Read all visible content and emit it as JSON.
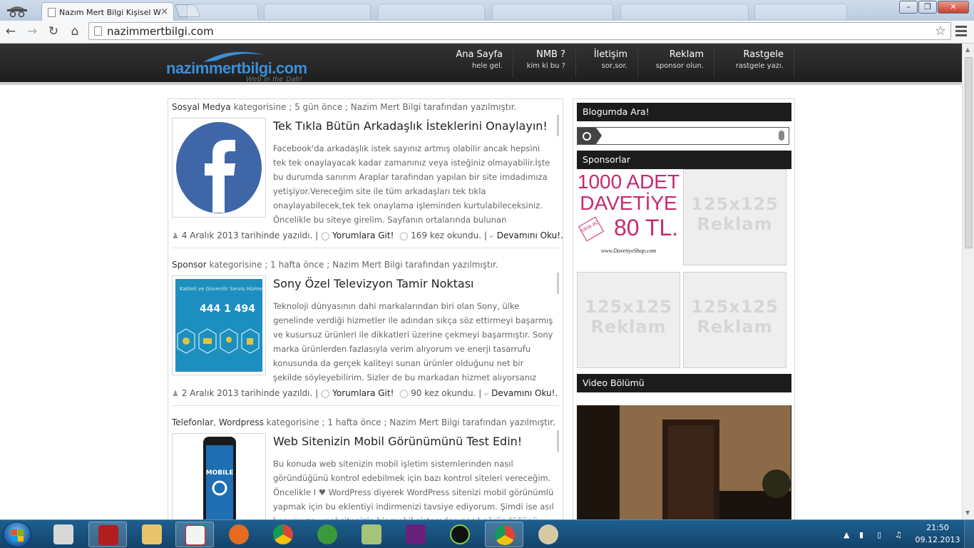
{
  "browser": {
    "active_tab_title": "Nazım Mert Bilgi Kişisel W",
    "url": "nazimmertbilgi.com",
    "close_glyph": "×"
  },
  "site": {
    "logo_text": "nazimmertbilgi.com",
    "logo_tagline": "Web in the Dah!",
    "nav": [
      {
        "title": "Ana Sayfa",
        "sub": "hele gel."
      },
      {
        "title": "NMB ?",
        "sub": "kim ki bu ?"
      },
      {
        "title": "İletişim",
        "sub": "sor,sor."
      },
      {
        "title": "Reklam",
        "sub": "sponsor olun."
      },
      {
        "title": "Rastgele",
        "sub": "rastgele yazı."
      }
    ]
  },
  "posts": [
    {
      "category": "Sosyal Medya",
      "meta_rest": " kategorisine ; 5 gün önce ;  Nazim Mert Bilgi  tarafından yazılmıştır.",
      "title": "Tek Tıkla Bütün Arkadaşlık İsteklerini Onaylayın!",
      "excerpt": "Facebook'da arkadaşlık istek sayınız artmış olabilir ancak hepsini tek tek onaylayacak kadar zamanınız veya isteğiniz olmayabilir.İşte bu durumda sanırım Araplar tarafından yapılan bir site imdadımıza yetişiyor.Vereceğim site ile tüm arkadaşları tek tıkla onaylayabilecek,tek tek onaylama işleminden kurtulabileceksiniz. Öncelikle bu siteye girelim. Sayfanın ortalarında bulunan",
      "date": "4 Aralık 2013 tarihinde yazıldı. |",
      "comments": "Yorumlara Git!",
      "views": "169 kez okundu. |",
      "more": "Devamını Oku!."
    },
    {
      "category": "Sponsor",
      "meta_rest": " kategorisine ; 1 hafta önce ;  Nazim Mert Bilgi  tarafından yazılmıştır.",
      "title": "Sony Özel Televizyon Tamir Noktası",
      "excerpt": "Teknoloji dünyasının dahi markalarından biri olan Sony, ülke genelinde verdiği hizmetler ile adından sıkça söz ettirmeyi başarmış ve kusursuz ürünleri ile dikkatleri üzerine çekmeyi başarmıştır. Sony marka ürünlerden fazlasıyla verim alıyorum ve enerji tasarrufu konusunda da gerçek kaliteyi sunan ürünler olduğunu net bir şekilde söyleyebilirim. Sizler de bu markadan hizmet alıyorsanız",
      "date": "2 Aralık 2013 tarihinde yazıldı. |",
      "comments": "Yorumlara Git!",
      "views": "90 kez okundu. |",
      "more": "Devamını Oku!.",
      "thumb_caption": "Kaliteli ve Güvenilir Servis Hizmeti",
      "thumb_phone": "444 1 494"
    },
    {
      "category": "Telefonlar",
      "category2": "Wordpress",
      "meta_rest": " kategorisine ; 1 hafta önce ;  Nazim Mert Bilgi  tarafından yazılmıştır.",
      "title": "Web Sitenizin Mobil Görünümünü Test Edin!",
      "excerpt": "Bu konuda web sitenizin mobil işletim sistemlerinden nasıl göründüğünü kontrol edebilmek için bazı kontrol siteleri vereceğim. Öncelikle I ♥  WordPress diyerek WordPress sitenizi mobil görünümlü yapmak için bu eklentiyi indirmenizi tavsiye ediyorum. Şimdi ise asıl konumuza , websitenizin bir mobil sistemden nasıl göründüğünü kontrol etme",
      "thumb_label": "MOBILE"
    }
  ],
  "sidebar": {
    "search_title": "Blogumda Ara!",
    "sponsors_title": "Sponsorlar",
    "davetiye_line1": "1000 ADET",
    "davetiye_line2": "DAVETİYE",
    "davetiye_price": "80 TL.",
    "davetiye_badge": "tıkla aç",
    "davetiye_site": "www.DavetiyeShop.com",
    "ad_line1": "125x125",
    "ad_line2": "Reklam",
    "video_title": "Video Bölümü"
  },
  "taskbar": {
    "time": "21:50",
    "date": "09.12.2013"
  },
  "colors": {
    "header_bg": "#1e1e1e",
    "logo_blue": "#3c8ed6",
    "widget_head": "#1c1c1c",
    "taskbar": "#13446b"
  }
}
